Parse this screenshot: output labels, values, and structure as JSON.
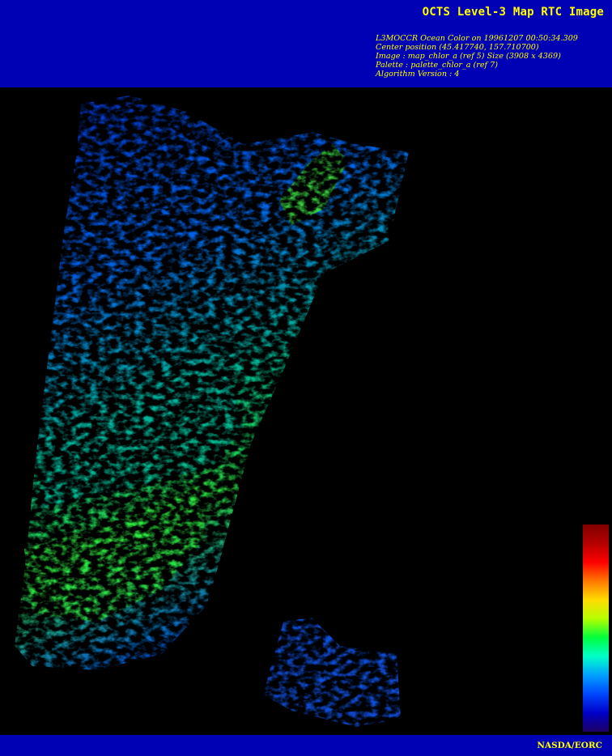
{
  "header": {
    "title": "OCTS Level-3 Map RTC Image",
    "info_lines": [
      "L3MOCCR Ocean Color on 19961207 00:50:34.309",
      "Center position (45.417740, 157.710700)",
      "Image : map_chlor_a (ref 5) Size (3908 x 4369)",
      "Palette : palette_chlor_a (ref 7)",
      "Algorithm Version : 4"
    ]
  },
  "footer": {
    "credit": "NASDA/EORC"
  },
  "colorbar": {
    "colors_bottom_to_top": [
      "#1e0064",
      "#0000c8",
      "#0046ff",
      "#00a0ff",
      "#00ffc8",
      "#00ff3c",
      "#b4ff00",
      "#ffdc00",
      "#ff7800",
      "#ff0000",
      "#b40000",
      "#820000"
    ]
  },
  "colors": {
    "header_bg": "#0000b4",
    "text": "#ffff00",
    "image_bg": "#000000"
  }
}
